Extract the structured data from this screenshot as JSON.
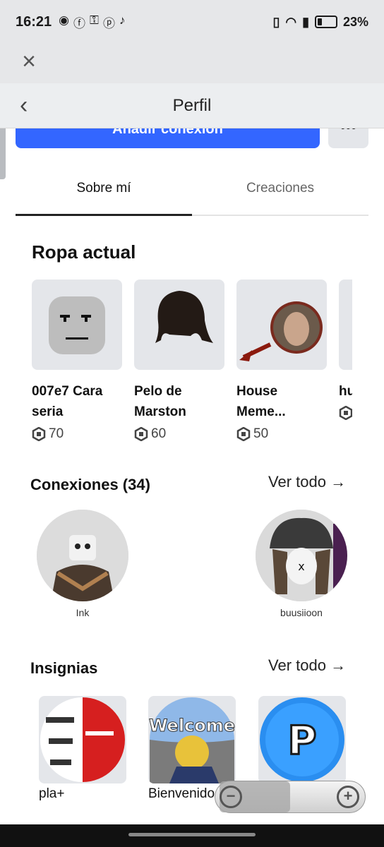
{
  "status": {
    "time": "16:21",
    "battery": "23%",
    "battery_level": 0.23
  },
  "header": {
    "title": "Perfil"
  },
  "profile": {
    "connect_label": "Añadir conexión",
    "more_label": "•••"
  },
  "tabs": [
    {
      "label": "Sobre mí"
    },
    {
      "label": "Creaciones"
    }
  ],
  "outfit": {
    "title": "Ropa actual",
    "items": [
      {
        "name": "007e7 Cara seria",
        "price": "70"
      },
      {
        "name": "Pelo de Marston",
        "price": "60"
      },
      {
        "name": "House Meme...",
        "price": "50"
      },
      {
        "name": "hu ov",
        "price": ""
      }
    ]
  },
  "connections": {
    "title": "Conexiones (34)",
    "view_all": "Ver todo →",
    "items": [
      {
        "name": "Ink"
      },
      {
        "name": "buusiioon"
      }
    ]
  },
  "badges": {
    "title": "Insignias",
    "view_all": "Ver todo →",
    "items": [
      {
        "name": "pla+"
      },
      {
        "name": "Bienvenido"
      },
      {
        "name": "",
        "thumb_text": "P"
      }
    ],
    "welcome_text": "Welcome"
  },
  "icons": [
    "close-icon",
    "back-icon",
    "more-icon",
    "robux-icon",
    "zoom-out-icon",
    "zoom-in-icon"
  ],
  "colors": {
    "accent": "#3366ff",
    "header_bg": "#eceef0",
    "status_bg": "#e6e7e9"
  }
}
